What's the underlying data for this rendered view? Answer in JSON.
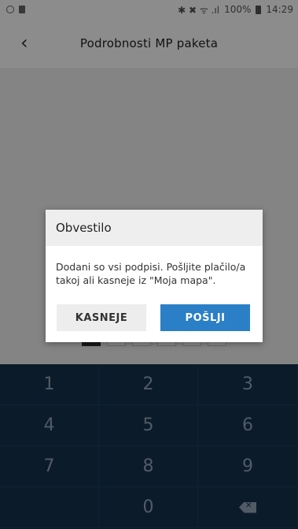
{
  "status_bar": {
    "signal_text": "✱ ✖︎ ᯤ .ıl",
    "battery": "100%",
    "time": "14:29"
  },
  "header": {
    "back_icon": "chevron-left-icon",
    "title": "Podrobnosti MP paketa"
  },
  "pin": {
    "length": 6,
    "filled": 1
  },
  "keypad": {
    "keys": [
      "1",
      "2",
      "3",
      "4",
      "5",
      "6",
      "7",
      "8",
      "9",
      "",
      "0",
      "backspace-icon"
    ]
  },
  "dialog": {
    "title": "Obvestilo",
    "message": "Dodani so vsi podpisi. Pošljite plačilo/a takoj ali kasneje iz \"Moja mapa\".",
    "later_label": "KASNEJE",
    "send_label": "POŠLJI"
  },
  "colors": {
    "keypad_bg": "#16324d",
    "primary_button": "#2a7fc6",
    "dim_overlay": "rgba(0,0,0,0.45)"
  }
}
